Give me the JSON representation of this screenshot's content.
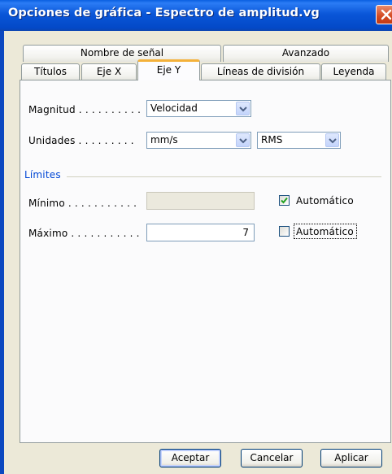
{
  "window": {
    "title": "Opciones de gráfica - Espectro de amplitud.vg",
    "close_icon": "close-icon"
  },
  "tabs": {
    "row_back": [
      {
        "label": "Nombre de señal"
      },
      {
        "label": "Avanzado"
      }
    ],
    "row_front": [
      {
        "label": "Títulos"
      },
      {
        "label": "Eje X"
      },
      {
        "label": "Eje Y",
        "selected": true
      },
      {
        "label": "Líneas de división"
      },
      {
        "label": "Leyenda"
      }
    ]
  },
  "form": {
    "magnitud": {
      "label": "Magnitud . . . . . . . . . .",
      "value": "Velocidad"
    },
    "unidades": {
      "label": "Unidades . . . . . . . . .",
      "value": "mm/s",
      "type_value": "RMS"
    },
    "limites": {
      "section_label": "Límites",
      "minimo": {
        "label": "Mínimo . . . . . . . . . . .",
        "value": "",
        "auto_label": "Automático",
        "auto_checked": true
      },
      "maximo": {
        "label": "Máximo . . . . . . . . . . .",
        "value": "7",
        "auto_label": "Automático",
        "auto_checked": false
      }
    }
  },
  "buttons": {
    "ok": "Aceptar",
    "cancel": "Cancelar",
    "apply": "Aplicar"
  },
  "colors": {
    "titlebar": "#0a56d8",
    "active_tab_accent": "#f4b13a",
    "close_button": "#d34a22",
    "section_label": "#0046d5",
    "check": "#21a121"
  }
}
